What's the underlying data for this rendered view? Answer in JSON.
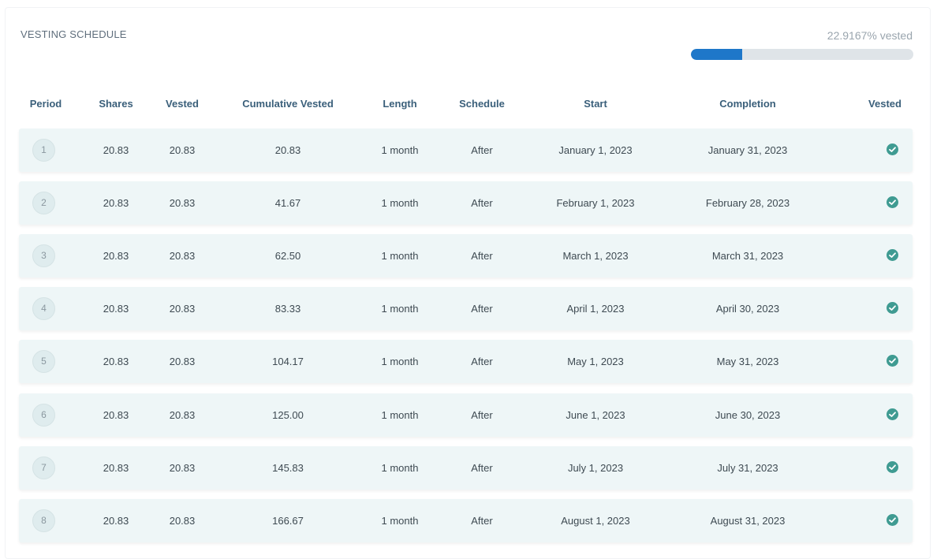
{
  "header": {
    "title": "VESTING SCHEDULE",
    "vested_percent_label": "22.9167% vested",
    "vested_fraction": 0.229167
  },
  "colors": {
    "progress_fill": "#1e77c9",
    "progress_track": "#dfe4e8",
    "check": "#3f9b92",
    "row_bg": "#eef6f7",
    "header_text": "#3a5f7a"
  },
  "table": {
    "columns": [
      "Period",
      "Shares",
      "Vested",
      "Cumulative Vested",
      "Length",
      "Schedule",
      "Start",
      "Completion",
      "Vested"
    ],
    "rows": [
      {
        "period": "1",
        "shares": "20.83",
        "vested": "20.83",
        "cumulative": "20.83",
        "length": "1 month",
        "schedule": "After",
        "start": "January 1, 2023",
        "completion": "January 31, 2023",
        "is_vested": true,
        "status_icon": "check-circle-icon"
      },
      {
        "period": "2",
        "shares": "20.83",
        "vested": "20.83",
        "cumulative": "41.67",
        "length": "1 month",
        "schedule": "After",
        "start": "February 1, 2023",
        "completion": "February 28, 2023",
        "is_vested": true,
        "status_icon": "check-circle-icon"
      },
      {
        "period": "3",
        "shares": "20.83",
        "vested": "20.83",
        "cumulative": "62.50",
        "length": "1 month",
        "schedule": "After",
        "start": "March 1, 2023",
        "completion": "March 31, 2023",
        "is_vested": true,
        "status_icon": "check-circle-icon"
      },
      {
        "period": "4",
        "shares": "20.83",
        "vested": "20.83",
        "cumulative": "83.33",
        "length": "1 month",
        "schedule": "After",
        "start": "April 1, 2023",
        "completion": "April 30, 2023",
        "is_vested": true,
        "status_icon": "check-circle-icon"
      },
      {
        "period": "5",
        "shares": "20.83",
        "vested": "20.83",
        "cumulative": "104.17",
        "length": "1 month",
        "schedule": "After",
        "start": "May 1, 2023",
        "completion": "May 31, 2023",
        "is_vested": true,
        "status_icon": "check-circle-icon"
      },
      {
        "period": "6",
        "shares": "20.83",
        "vested": "20.83",
        "cumulative": "125.00",
        "length": "1 month",
        "schedule": "After",
        "start": "June 1, 2023",
        "completion": "June 30, 2023",
        "is_vested": true,
        "status_icon": "check-circle-icon"
      },
      {
        "period": "7",
        "shares": "20.83",
        "vested": "20.83",
        "cumulative": "145.83",
        "length": "1 month",
        "schedule": "After",
        "start": "July 1, 2023",
        "completion": "July 31, 2023",
        "is_vested": true,
        "status_icon": "check-circle-icon"
      },
      {
        "period": "8",
        "shares": "20.83",
        "vested": "20.83",
        "cumulative": "166.67",
        "length": "1 month",
        "schedule": "After",
        "start": "August 1, 2023",
        "completion": "August 31, 2023",
        "is_vested": true,
        "status_icon": "check-circle-icon"
      }
    ]
  }
}
